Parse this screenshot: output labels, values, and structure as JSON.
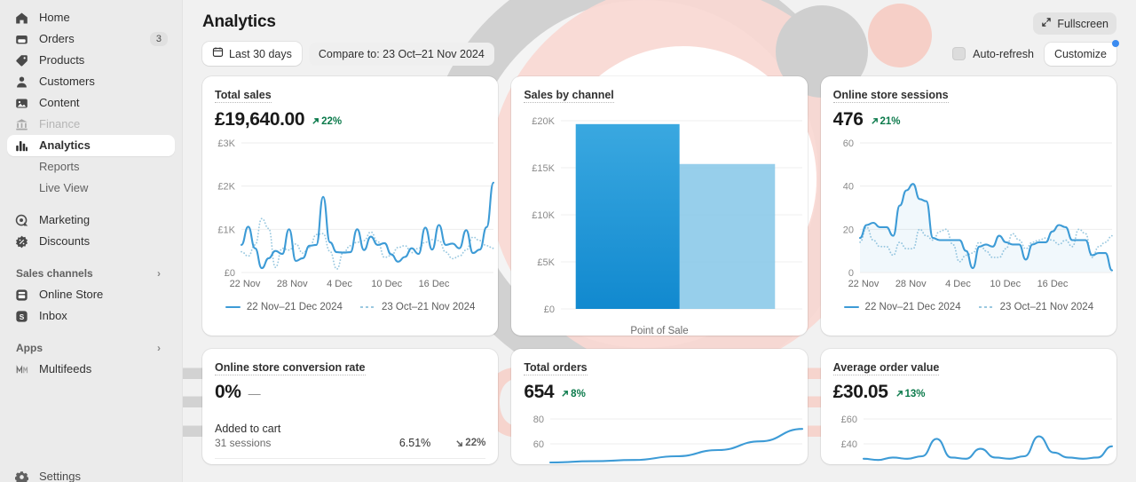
{
  "sidebar": {
    "items": [
      {
        "label": "Home",
        "icon": "home-icon",
        "state": "normal"
      },
      {
        "label": "Orders",
        "icon": "orders-icon",
        "state": "normal",
        "badge": "3"
      },
      {
        "label": "Products",
        "icon": "products-icon",
        "state": "normal"
      },
      {
        "label": "Customers",
        "icon": "customers-icon",
        "state": "normal"
      },
      {
        "label": "Content",
        "icon": "content-icon",
        "state": "normal"
      },
      {
        "label": "Finance",
        "icon": "finance-icon",
        "state": "disabled"
      },
      {
        "label": "Analytics",
        "icon": "analytics-icon",
        "state": "active"
      },
      {
        "label": "Reports",
        "icon": "none",
        "state": "sub"
      },
      {
        "label": "Live View",
        "icon": "none",
        "state": "sub"
      },
      {
        "label": "Marketing",
        "icon": "marketing-icon",
        "state": "normal"
      },
      {
        "label": "Discounts",
        "icon": "discounts-icon",
        "state": "normal"
      }
    ],
    "sales_channels": {
      "label": "Sales channels",
      "chevron": "›",
      "items": [
        {
          "label": "Online Store",
          "icon": "online-store-icon"
        },
        {
          "label": "Inbox",
          "icon": "inbox-icon"
        }
      ]
    },
    "apps": {
      "label": "Apps",
      "chevron": "›",
      "items": [
        {
          "label": "Multifeeds",
          "icon": "multifeeds-icon"
        }
      ]
    },
    "settings": {
      "label": "Settings",
      "icon": "settings-icon"
    }
  },
  "header": {
    "title": "Analytics",
    "fullscreen_label": "Fullscreen",
    "fullscreen_icon": "expand-icon"
  },
  "toolbar": {
    "date_range": "Last 30 days",
    "date_range_icon": "calendar-icon",
    "compare": "Compare to: 23 Oct–21 Nov 2024",
    "auto_refresh": "Auto-refresh",
    "customize": "Customize"
  },
  "watermark": {
    "text_grey": "ECOM",
    "text_pink": "OXYGEN"
  },
  "colors": {
    "accent_line": "#3d9bd6",
    "accent_line_dashed": "#9bc9e0",
    "bar_primary": "#2b9ad9",
    "bar_compare": "#85c7e8",
    "positive": "#0b7a4b",
    "notification": "#3b8bf0"
  },
  "cards": [
    {
      "name": "total-sales",
      "title": "Total sales",
      "metric": "£19,640.00",
      "delta": "22%",
      "delta_dir": "up",
      "chart_data": {
        "type": "line",
        "title": "Total sales",
        "xlabel": "",
        "ylabel": "",
        "ylim": [
          0,
          3000
        ],
        "ytick_labels": [
          "£3K",
          "£2K",
          "£1K",
          "£0"
        ],
        "yticks": [
          3000,
          2000,
          1000,
          0
        ],
        "xtick_labels": [
          "22 Nov",
          "28 Nov",
          "4 Dec",
          "10 Dec",
          "16 Dec"
        ],
        "grid": true,
        "legend": [
          "22 Nov–21 Dec 2024",
          "23 Oct–21 Nov 2024"
        ],
        "legend_position": "bottom",
        "series": [
          {
            "name": "22 Nov–21 Dec 2024",
            "style": "solid",
            "values": [
              640,
              1060,
              560,
              100,
              330,
              500,
              430,
              1000,
              270,
              330,
              620,
              640,
              1750,
              700,
              470,
              460,
              470,
              1000,
              520,
              830,
              640,
              680,
              420,
              250,
              360,
              560,
              430,
              1040,
              530,
              1100,
              640,
              670,
              560,
              980,
              450,
              530,
              1050,
              2080
            ]
          },
          {
            "name": "23 Oct–21 Nov 2024",
            "style": "dotted",
            "values": [
              480,
              380,
              640,
              1250,
              1020,
              120,
              560,
              520,
              660,
              450,
              580,
              880,
              900,
              490,
              80,
              470,
              620,
              700,
              740,
              940,
              720,
              350,
              390,
              580,
              620,
              460,
              560,
              700,
              760,
              740,
              470,
              320,
              380,
              520,
              820,
              740,
              620,
              560
            ]
          }
        ]
      }
    },
    {
      "name": "sales-by-channel",
      "title": "Sales by channel",
      "chart_data": {
        "type": "bar",
        "title": "Sales by channel",
        "categories": [
          "Point of Sale"
        ],
        "ylim": [
          0,
          20000
        ],
        "ytick_labels": [
          "£20K",
          "£15K",
          "£10K",
          "£5K",
          "£0"
        ],
        "yticks": [
          20000,
          15000,
          10000,
          5000,
          0
        ],
        "xtick_labels": [
          "Point of Sale"
        ],
        "grid": true,
        "series": [
          {
            "name": "22 Nov–21 Dec 2024",
            "values": [
              19640
            ],
            "color": "#2b9ad9"
          },
          {
            "name": "23 Oct–21 Nov 2024",
            "values": [
              15400
            ],
            "color": "#85c7e8"
          }
        ]
      }
    },
    {
      "name": "online-store-sessions",
      "title": "Online store sessions",
      "metric": "476",
      "delta": "21%",
      "delta_dir": "up",
      "chart_data": {
        "type": "line",
        "title": "Online store sessions",
        "ylim": [
          0,
          60
        ],
        "ytick_labels": [
          "60",
          "40",
          "20",
          "0"
        ],
        "yticks": [
          60,
          40,
          20,
          0
        ],
        "xtick_labels": [
          "22 Nov",
          "28 Nov",
          "4 Dec",
          "10 Dec",
          "16 Dec"
        ],
        "grid": true,
        "legend": [
          "22 Nov–21 Dec 2024",
          "23 Oct–21 Nov 2024"
        ],
        "legend_position": "bottom",
        "series": [
          {
            "name": "22 Nov–21 Dec 2024",
            "style": "solid",
            "values": [
              16,
              22,
              23,
              21,
              21,
              17,
              31,
              38,
              41,
              34,
              33,
              16,
              15,
              15,
              15,
              15,
              10,
              2,
              12,
              13,
              12,
              17,
              14,
              13,
              13,
              6,
              13,
              14,
              14,
              19,
              22,
              21,
              15,
              15,
              15,
              8,
              9,
              9,
              1
            ]
          },
          {
            "name": "23 Oct–21 Nov 2024",
            "style": "dotted",
            "values": [
              14,
              21,
              15,
              12,
              12,
              8,
              14,
              11,
              11,
              20,
              17,
              15,
              19,
              20,
              13,
              5,
              8,
              9,
              14,
              10,
              7,
              7,
              11,
              18,
              15,
              11,
              14,
              15,
              16,
              15,
              13,
              15,
              12,
              20,
              18,
              7,
              12,
              14,
              17
            ]
          }
        ]
      }
    },
    {
      "name": "online-store-conversion-rate",
      "title": "Online store conversion rate",
      "metric": "0%",
      "delta": "—",
      "delta_dir": "flat",
      "breakdown": [
        {
          "label": "Added to cart",
          "sub": "31 sessions",
          "value": "6.51%",
          "delta": "22%",
          "delta_dir": "down"
        }
      ]
    },
    {
      "name": "total-orders",
      "title": "Total orders",
      "metric": "654",
      "delta": "8%",
      "delta_dir": "up",
      "chart_data": {
        "type": "line",
        "title": "Total orders",
        "ylim": [
          40,
          80
        ],
        "ytick_labels": [
          "80",
          "60"
        ],
        "yticks": [
          80,
          60
        ],
        "grid": true,
        "series": [
          {
            "name": "22 Nov–21 Dec 2024",
            "style": "solid",
            "values": [
              45,
              46,
              47,
              50,
              55,
              62,
              72
            ]
          }
        ]
      }
    },
    {
      "name": "average-order-value",
      "title": "Average order value",
      "metric": "£30.05",
      "delta": "13%",
      "delta_dir": "up",
      "chart_data": {
        "type": "line",
        "title": "Average order value",
        "ylim": [
          20,
          60
        ],
        "ytick_labels": [
          "£60",
          "£40"
        ],
        "yticks": [
          60,
          40
        ],
        "grid": true,
        "series": [
          {
            "name": "22 Nov–21 Dec 2024",
            "style": "solid",
            "values": [
              28,
              27,
              29,
              28,
              30,
              44,
              29,
              28,
              36,
              29,
              28,
              30,
              46,
              33,
              29,
              28,
              29,
              38
            ]
          }
        ]
      }
    }
  ]
}
